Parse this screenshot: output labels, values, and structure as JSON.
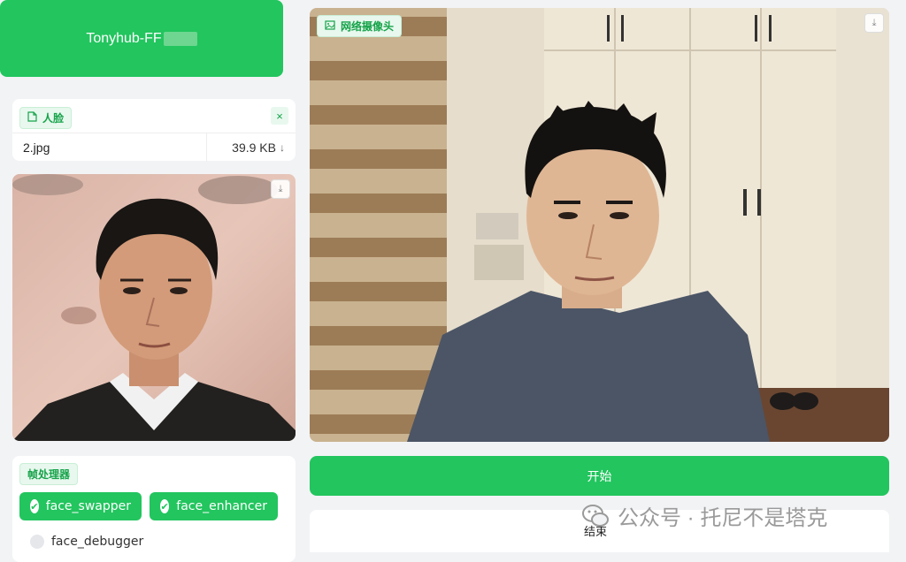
{
  "header": {
    "title": "Tonyhub-FF"
  },
  "file_panel": {
    "label": "人脸",
    "close_icon": "×",
    "file_name": "2.jpg",
    "file_size": "39.9 KB",
    "download_icon": "↓"
  },
  "webcam": {
    "label": "网络摄像头"
  },
  "processor": {
    "label": "帧处理器",
    "options": [
      {
        "label": "face_swapper",
        "checked": true
      },
      {
        "label": "face_enhancer",
        "checked": true
      },
      {
        "label": "face_debugger",
        "checked": false
      }
    ]
  },
  "buttons": {
    "start": "开始",
    "end": "结束"
  },
  "watermark": {
    "text": "公众号 · 托尼不是塔克"
  },
  "colors": {
    "accent": "#22c55e",
    "accent_light": "#e8f8ee",
    "background": "#f2f3f5"
  }
}
